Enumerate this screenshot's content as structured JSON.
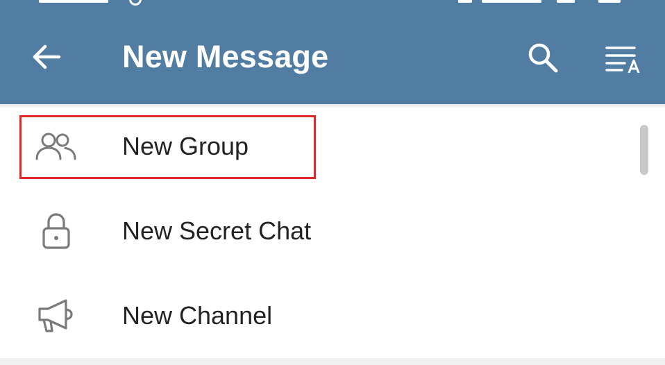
{
  "toolbar": {
    "title": "New Message",
    "back_icon": "arrow-left-icon",
    "search_icon": "search-icon",
    "sort_icon": "sort-alpha-icon",
    "background": "#527da3"
  },
  "menu": {
    "items": [
      {
        "label": "New Group",
        "icon": "group-icon",
        "highlighted": true
      },
      {
        "label": "New Secret Chat",
        "icon": "lock-icon",
        "highlighted": false
      },
      {
        "label": "New Channel",
        "icon": "megaphone-icon",
        "highlighted": false
      }
    ]
  },
  "colors": {
    "accent": "#527da3",
    "highlight": "#e02a2a",
    "text": "#222222",
    "icon": "#7a7a7a"
  }
}
